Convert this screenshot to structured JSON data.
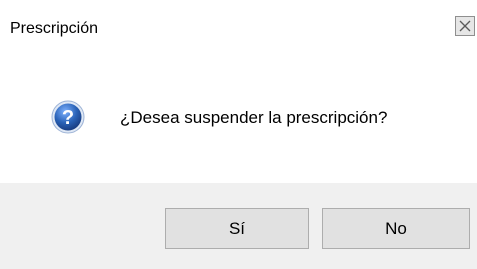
{
  "window": {
    "title": "Prescripción",
    "close_icon": "close-icon"
  },
  "dialog": {
    "icon": "question-icon",
    "message": "¿Desea suspender la prescripción?"
  },
  "buttons": {
    "yes_label": "Sí",
    "no_label": "No"
  },
  "colors": {
    "footer_bg": "#f0f0f0",
    "button_bg": "#e1e1e1",
    "icon_blue": "#2a63b8"
  }
}
